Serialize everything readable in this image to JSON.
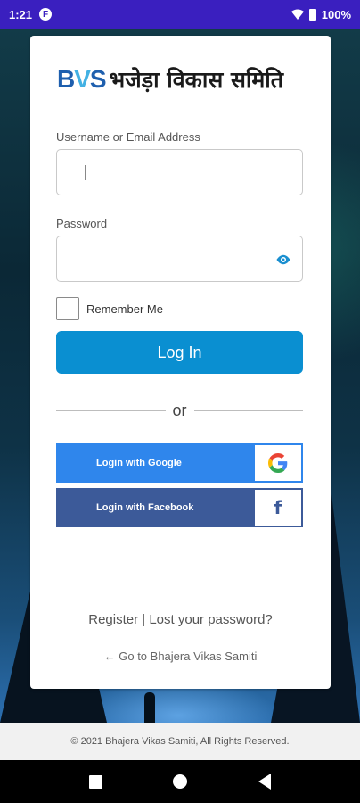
{
  "status_bar": {
    "time": "1:21",
    "app_badge": "F",
    "battery": "100%"
  },
  "logo": {
    "mark_b": "B",
    "mark_v": "V",
    "mark_s": "S",
    "title": "भजेड़ा विकास समिति"
  },
  "form": {
    "username_label": "Username or Email Address",
    "username_value": "",
    "password_label": "Password",
    "password_value": "",
    "remember_label": "Remember Me",
    "remember_checked": false,
    "login_label": "Log In",
    "or_text": "or"
  },
  "social": {
    "google_label": "Login with Google",
    "facebook_label": "Login with Facebook",
    "facebook_icon_text": "f"
  },
  "links": {
    "register": "Register",
    "separator": "|",
    "lost_password": "Lost your password?",
    "go_to_site": "← Go to Bhajera Vikas Samiti"
  },
  "footer": {
    "copyright": "© 2021 Bhajera Vikas Samiti, All Rights Reserved."
  },
  "colors": {
    "status_bar": "#3a1fbf",
    "primary": "#0a8fd1",
    "google": "#2f86ec",
    "facebook": "#3c5a99"
  },
  "icons": [
    "eye-icon",
    "google-icon",
    "facebook-icon",
    "nav-back-icon",
    "nav-home-icon",
    "nav-recents-icon"
  ]
}
